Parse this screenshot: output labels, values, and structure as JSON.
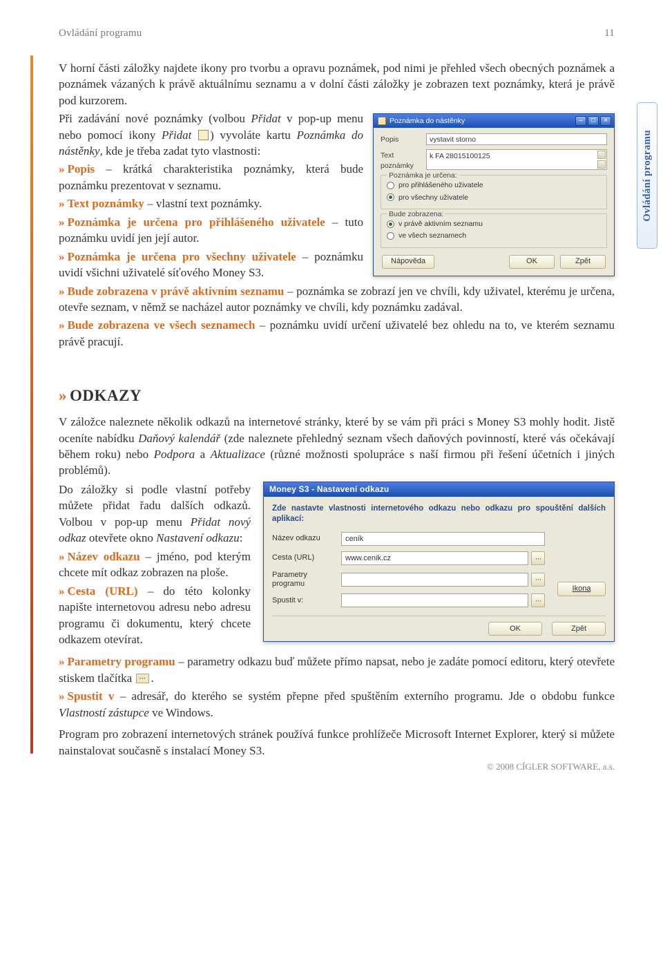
{
  "page": {
    "running_head": "Ovládání programu",
    "page_number": "11",
    "side_tab": "Ovládání programu",
    "footer": "© 2008 CÍGLER SOFTWARE, a.s."
  },
  "para1": "V horní části záložky najdete ikony pro tvorbu a opravu poznámek, pod nimi je přehled všech obecných poznámek a poznámek vázaných k právě aktuálnímu seznamu a v dolní části záložky je zobrazen text poznámky, která je právě pod kurzorem.",
  "para2_pre": "Při zadávání nové poznámky (volbou ",
  "para2_add1": "Přidat",
  "para2_mid1": " v pop-up menu nebo pomocí ikony ",
  "para2_add2": "Přidat",
  "para2_mid2": " ) vyvoláte kartu ",
  "para2_karta": "Poznámka do nástěnky",
  "para2_tail": ", kde je třeba zadat tyto vlastnosti:",
  "b_popis": {
    "lead": "Popis",
    "tail": " – krátká charakteristika poznámky, která bude poznámku prezentovat v seznamu."
  },
  "b_text": {
    "lead": "Text poznámky",
    "tail": " – vlastní text poznámky."
  },
  "b_pri": {
    "lead": "Poznámka je určena pro přihlášeného uživatele",
    "tail": " – tuto poznámku uvidí jen její autor."
  },
  "b_vse": {
    "lead": "Poznámka je určena pro všechny uživatele",
    "tail": " – poznámku uvidí všichni uživatelé síťového Money S3."
  },
  "b_akt": {
    "lead": "Bude zobrazena v právě aktivním seznamu",
    "tail": " – poznámka se zobrazí jen ve chvíli, kdy uživatel, kterému je určena, otevře seznam, v němž se nacházel autor poznámky ve chvíli, kdy poznámku zadával."
  },
  "b_all": {
    "lead": "Bude zobrazena ve všech seznamech",
    "tail": " – poznámku uvidí určení uživatelé bez ohledu na to, ve kterém seznamu právě pracují."
  },
  "win1": {
    "title": "Poznámka do nástěnky",
    "popis_label": "Popis",
    "popis_value": "vystavit storno",
    "text_label": "Text poznámky",
    "text_value": "k FA 28015100125",
    "grp1": "Poznámka je určena:",
    "opt1a": "pro přihlášeného uživatele",
    "opt1b": "pro všechny uživatele",
    "grp2": "Bude zobrazena:",
    "opt2a": "v právě aktivním seznamu",
    "opt2b": "ve všech seznamech",
    "help": "Nápověda",
    "ok": "OK",
    "back": "Zpět"
  },
  "section_odkazy": "ODKAZY",
  "odk_p1_a": "V záložce naleznete několik odkazů na internetové stránky, které by se vám při práci s Money S3 mohly hodit. Jistě oceníte nabídku ",
  "odk_p1_i1": "Daňový kalendář",
  "odk_p1_b": " (zde naleznete přehledný seznam všech daňových povinností, které vás očekávají během roku) nebo ",
  "odk_p1_i2": "Podpora",
  "odk_p1_c": " a ",
  "odk_p1_i3": "Aktualizace",
  "odk_p1_d": " (různé možnosti spolupráce s naší firmou při řešení účetních i jiných problémů).",
  "odk_left_a": "Do záložky si podle vlastní potřeby můžete přidat řadu dalších odkazů. Volbou v pop-up menu ",
  "odk_left_i1": "Přidat nový odkaz",
  "odk_left_b": " otevřete okno ",
  "odk_left_i2": "Nastavení odkazu",
  "odk_left_c": ":",
  "odk_nazev": {
    "lead": "Název odkazu",
    "tail": " – jméno, pod kterým chcete mít odkaz zobrazen na ploše."
  },
  "odk_cesta": {
    "lead": "Cesta (URL)",
    "tail": " – do této kolonky napište internetovou adresu nebo adresu programu či dokumentu, který chcete odkazem otevírat."
  },
  "odk_param_lead": "Parametry programu",
  "odk_param_tail": " – parametry odkazu buď můžete přímo napsat, nebo je zadáte pomocí editoru, který otevřete stiskem tlačítka ",
  "odk_param_dot": ".",
  "odk_spustit_lead": "Spustit v",
  "odk_spustit_tail_a": " – adresář, do kterého se systém   přepne  před  spuštěním  externího  programu. Jde o obdobu funkce ",
  "odk_spustit_i": "Vlastností zástupce",
  "odk_spustit_tail_b": " ve Windows.",
  "odk_final": "Program pro zobrazení internetových stránek používá funkce prohlížeče Microsoft Internet Explorer, který si můžete nainstalovat současně s instalací Money S3.",
  "win2": {
    "title": "Money   S3 - Nastavení odkazu",
    "intro": "Zde nastavte vlastnosti internetového odkazu nebo odkazu pro spouštění dalších aplikací:",
    "l_nazev": "Název odkazu",
    "v_nazev": "ceník",
    "l_cesta": "Cesta (URL)",
    "v_cesta": "www.cenik.cz",
    "l_param": "Parametry programu",
    "l_spustit": "Spustit v:",
    "ikona": "Ikona",
    "ok": "OK",
    "back": "Zpět"
  }
}
